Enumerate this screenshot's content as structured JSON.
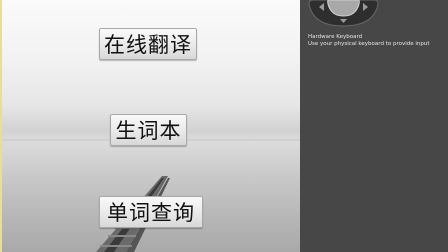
{
  "app": {
    "buttons": [
      {
        "label": "在线翻译"
      },
      {
        "label": "生词本"
      },
      {
        "label": "单词查询"
      }
    ]
  },
  "emulator": {
    "keyboard_title": "Hardware Keyboard",
    "keyboard_description": "Use your physical keyboard to provide input"
  },
  "colors": {
    "side_panel": "#474747",
    "button_face": "#e9e9e9",
    "button_text": "#111111"
  }
}
